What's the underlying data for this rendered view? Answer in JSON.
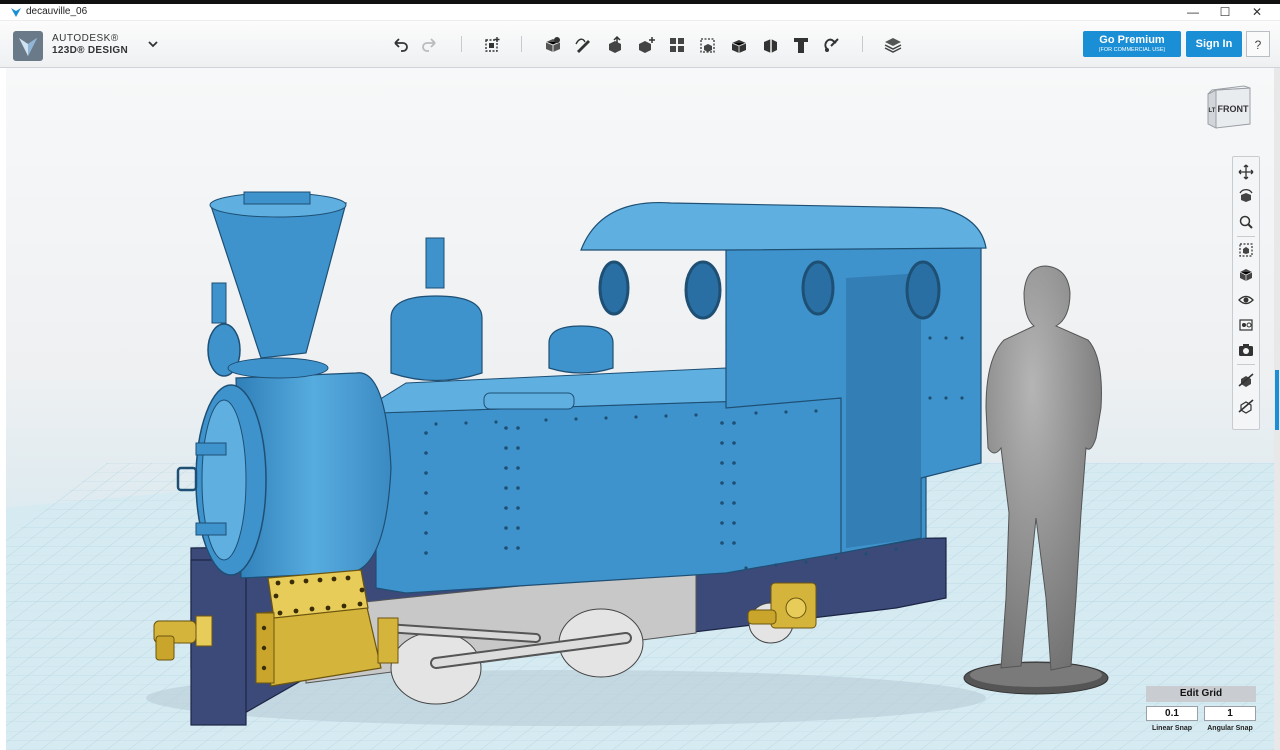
{
  "window": {
    "title": "decauville_06",
    "min_glyph": "—",
    "max_glyph": "☐",
    "close_glyph": "✕"
  },
  "brand": {
    "line1": "AUTODESK®",
    "line2": "123D® DESIGN",
    "logo_icon": "autodesk-123d-logo",
    "menu_icon": "chevron-down-icon"
  },
  "toolbar": {
    "tools": [
      {
        "name": "undo-icon"
      },
      {
        "name": "redo-icon"
      },
      {
        "name": "transform-icon"
      },
      {
        "name": "primitives-icon"
      },
      {
        "name": "sketch-icon"
      },
      {
        "name": "construct-icon"
      },
      {
        "name": "modify-icon"
      },
      {
        "name": "pattern-icon"
      },
      {
        "name": "group-icon"
      },
      {
        "name": "combine-icon"
      },
      {
        "name": "measure-icon"
      },
      {
        "name": "text-icon"
      },
      {
        "name": "snap-icon"
      },
      {
        "name": "material-icon"
      }
    ],
    "premium_label": "Go Premium",
    "premium_sub": "(FOR COMMERCIAL USE)",
    "signin_label": "Sign In",
    "help_label": "?"
  },
  "viewcube": {
    "front_label": "FRONT",
    "left_label": "LT"
  },
  "sidenav": {
    "items": [
      {
        "name": "pan-icon"
      },
      {
        "name": "orbit-icon"
      },
      {
        "name": "zoom-icon"
      },
      {
        "name": "fit-icon"
      },
      {
        "name": "materials-icon"
      },
      {
        "name": "visibility-icon"
      },
      {
        "name": "view-mode-icon"
      },
      {
        "name": "screenshot-icon"
      },
      {
        "name": "hide-icon"
      },
      {
        "name": "show-icon"
      }
    ]
  },
  "edit_grid": {
    "title": "Edit Grid",
    "linear_value": "0.1",
    "angular_value": "1",
    "linear_label": "Linear Snap",
    "angular_label": "Angular Snap"
  },
  "colors": {
    "accent": "#1a8fd6",
    "model_blue": "#4a9fd4",
    "brass": "#d4b43a",
    "chassis": "#3c4a7a",
    "figure_gray": "#8a8a8a"
  }
}
